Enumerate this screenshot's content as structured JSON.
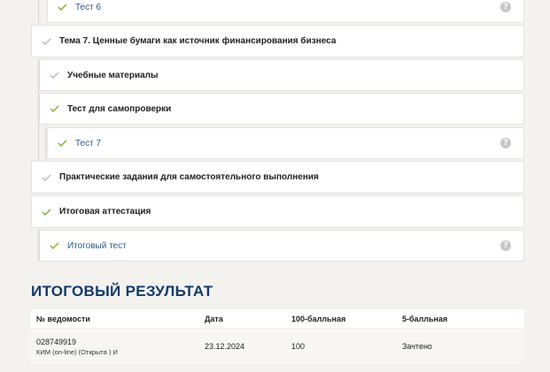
{
  "tree": {
    "test6": "Тест 6",
    "topic7": "Тема 7. Ценные бумаги как источник финансирования бизнеса",
    "materials": "Учебные материалы",
    "selfcheck": "Тест для самопроверки",
    "test7": "Тест 7",
    "practice": "Практические задания для самостоятельного выполнения",
    "final_cert": "Итоговая аттестация",
    "final_test": "Итоговый тест",
    "help_glyph": "?"
  },
  "result": {
    "title": "ИТОГОВЫЙ РЕЗУЛЬТАТ",
    "headers": [
      "№ ведомости",
      "Дата",
      "100-балльная",
      "5-балльная"
    ],
    "row": {
      "number": "028749919",
      "type": "КИМ (on-line) (Открыта ) И",
      "date": "23.12.2024",
      "score100": "100",
      "score5": "Зачтено"
    }
  },
  "colors": {
    "check_done": "#7fae2f",
    "check_pending": "#b9b9b9",
    "title_blue": "#133a6b",
    "link_blue": "#2a5a8a"
  }
}
